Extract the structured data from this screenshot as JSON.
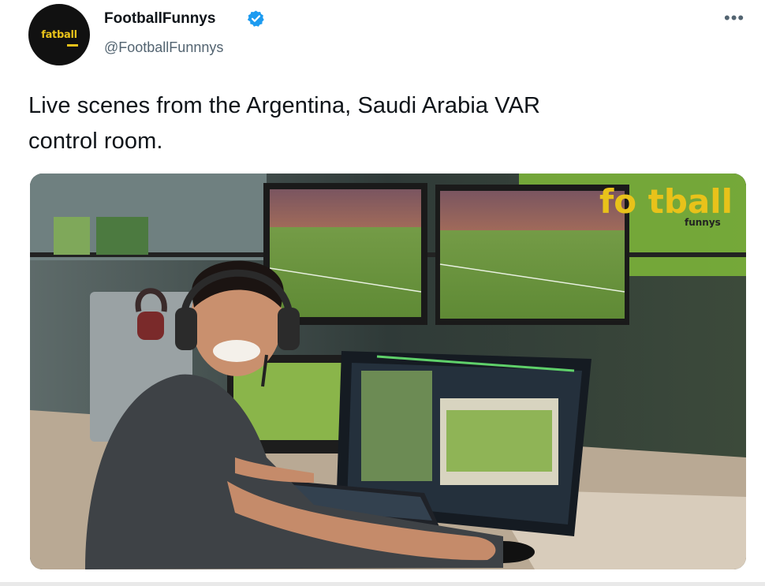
{
  "author": {
    "avatar_text": "fa⁠tball",
    "display_name": "FootballFunnys",
    "handle": "@FootballFunnnys",
    "verified": true
  },
  "more_icon": "more-horizontal-icon",
  "tweet": {
    "text_line1": "Live scenes from the Argentina, Saudi Arabia VAR",
    "text_line2": "control room."
  },
  "media": {
    "watermark_main": "fo tball",
    "watermark_sub": "funnys"
  },
  "colors": {
    "verified": "#1d9bf0",
    "secondary_text": "#536471",
    "watermark": "#e8c21a"
  }
}
